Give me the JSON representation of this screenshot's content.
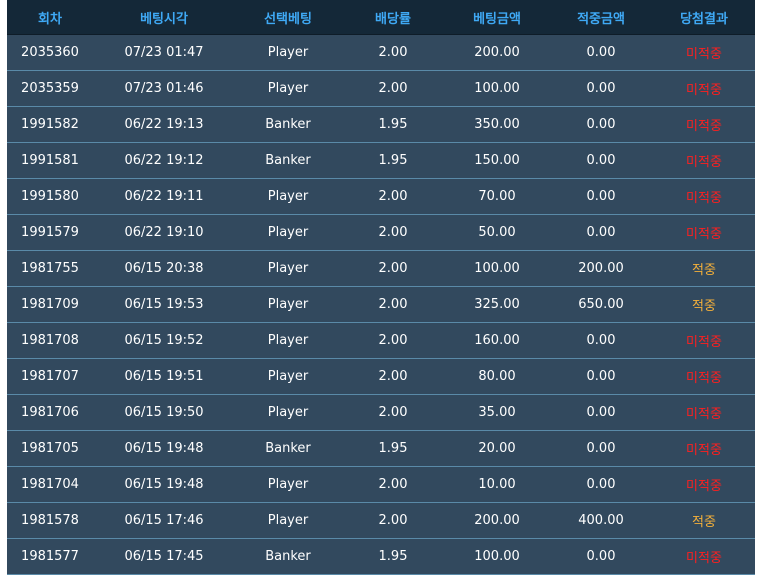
{
  "table": {
    "headers": [
      "회차",
      "베팅시각",
      "선택베팅",
      "배당률",
      "베팅금액",
      "적중금액",
      "당첨결과"
    ],
    "colors": {
      "header_text": "#3fa9f5",
      "miss": "#ff1f1f",
      "hit": "#f4b03a"
    },
    "rows": [
      {
        "round": "2035360",
        "time": "07/23 01:47",
        "pick": "Player",
        "odds": "2.00",
        "bet": "200.00",
        "win": "0.00",
        "result": "미적중",
        "status": "miss"
      },
      {
        "round": "2035359",
        "time": "07/23 01:46",
        "pick": "Player",
        "odds": "2.00",
        "bet": "100.00",
        "win": "0.00",
        "result": "미적중",
        "status": "miss"
      },
      {
        "round": "1991582",
        "time": "06/22 19:13",
        "pick": "Banker",
        "odds": "1.95",
        "bet": "350.00",
        "win": "0.00",
        "result": "미적중",
        "status": "miss"
      },
      {
        "round": "1991581",
        "time": "06/22 19:12",
        "pick": "Banker",
        "odds": "1.95",
        "bet": "150.00",
        "win": "0.00",
        "result": "미적중",
        "status": "miss"
      },
      {
        "round": "1991580",
        "time": "06/22 19:11",
        "pick": "Player",
        "odds": "2.00",
        "bet": "70.00",
        "win": "0.00",
        "result": "미적중",
        "status": "miss"
      },
      {
        "round": "1991579",
        "time": "06/22 19:10",
        "pick": "Player",
        "odds": "2.00",
        "bet": "50.00",
        "win": "0.00",
        "result": "미적중",
        "status": "miss"
      },
      {
        "round": "1981755",
        "time": "06/15 20:38",
        "pick": "Player",
        "odds": "2.00",
        "bet": "100.00",
        "win": "200.00",
        "result": "적중",
        "status": "hit"
      },
      {
        "round": "1981709",
        "time": "06/15 19:53",
        "pick": "Player",
        "odds": "2.00",
        "bet": "325.00",
        "win": "650.00",
        "result": "적중",
        "status": "hit"
      },
      {
        "round": "1981708",
        "time": "06/15 19:52",
        "pick": "Player",
        "odds": "2.00",
        "bet": "160.00",
        "win": "0.00",
        "result": "미적중",
        "status": "miss"
      },
      {
        "round": "1981707",
        "time": "06/15 19:51",
        "pick": "Player",
        "odds": "2.00",
        "bet": "80.00",
        "win": "0.00",
        "result": "미적중",
        "status": "miss"
      },
      {
        "round": "1981706",
        "time": "06/15 19:50",
        "pick": "Player",
        "odds": "2.00",
        "bet": "35.00",
        "win": "0.00",
        "result": "미적중",
        "status": "miss"
      },
      {
        "round": "1981705",
        "time": "06/15 19:48",
        "pick": "Banker",
        "odds": "1.95",
        "bet": "20.00",
        "win": "0.00",
        "result": "미적중",
        "status": "miss"
      },
      {
        "round": "1981704",
        "time": "06/15 19:48",
        "pick": "Player",
        "odds": "2.00",
        "bet": "10.00",
        "win": "0.00",
        "result": "미적중",
        "status": "miss"
      },
      {
        "round": "1981578",
        "time": "06/15 17:46",
        "pick": "Player",
        "odds": "2.00",
        "bet": "200.00",
        "win": "400.00",
        "result": "적중",
        "status": "hit"
      },
      {
        "round": "1981577",
        "time": "06/15 17:45",
        "pick": "Banker",
        "odds": "1.95",
        "bet": "100.00",
        "win": "0.00",
        "result": "미적중",
        "status": "miss"
      }
    ]
  }
}
